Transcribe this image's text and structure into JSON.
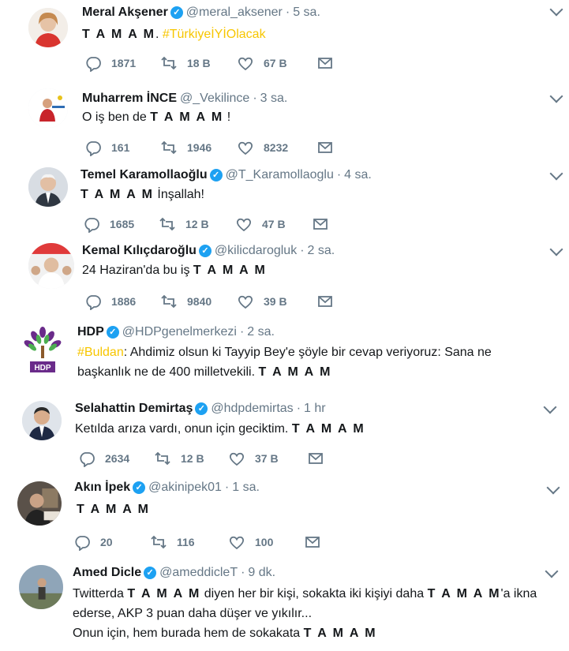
{
  "tweets": [
    {
      "name": "Meral Akşener",
      "verified": true,
      "handle": "@meral_aksener",
      "time": "5 sa.",
      "text": "T A M A M",
      "text_after": ".",
      "hashtag": "#TürkiyeİYİOlacak",
      "replies": "1871",
      "retweets": "18 B",
      "likes": "67 B"
    },
    {
      "name": "Muharrem İNCE",
      "verified": false,
      "handle": "@_Vekilince",
      "time": "3 sa.",
      "text_before": "O iş ben de",
      "text": "T A M A M",
      "text_after": "!",
      "replies": "161",
      "retweets": "1946",
      "likes": "8232"
    },
    {
      "name": "Temel Karamollaoğlu",
      "verified": true,
      "handle": "@T_Karamollaoglu",
      "time": "4 sa.",
      "text": "T A M A M",
      "text_after": "İnşallah!",
      "replies": "1685",
      "retweets": "12 B",
      "likes": "47 B"
    },
    {
      "name": "Kemal Kılıçdaroğlu",
      "verified": true,
      "handle": "@kilicdarogluk",
      "time": "2 sa.",
      "text_before": "24 Haziran'da bu iş",
      "text": "T A M A M",
      "replies": "1886",
      "retweets": "9840",
      "likes": "39 B"
    },
    {
      "name": "HDP",
      "verified": true,
      "handle": "@HDPgenelmerkezi",
      "time": "2 sa.",
      "hashtag": "#Buldan",
      "text_line1": ": Ahdimiz olsun ki Tayyip Bey'e şöyle bir cevap veriyoruz: Sana ne",
      "text_line2": "başkanlık ne de 400 milletvekili.",
      "text": "T A M A M",
      "avatar_label": "HDP"
    },
    {
      "name": "Selahattin Demirtaş",
      "verified": true,
      "handle": "@hdpdemirtas",
      "time": "1 hr",
      "text_before": "Ketılda arıza vardı, onun için geciktim.",
      "text": "T A M A M",
      "replies": "2634",
      "retweets": "12 B",
      "likes": "37 B"
    },
    {
      "name": "Akın İpek",
      "verified": true,
      "handle": "@akinipek01",
      "time": "1 sa.",
      "text": "T A M A M",
      "replies": "20",
      "retweets": "116",
      "likes": "100"
    },
    {
      "name": "Amed Dicle",
      "verified": true,
      "handle": "@ameddicleT",
      "time": "9 dk.",
      "line1_a": "Twitterda",
      "line1_b": "T A M A M",
      "line1_c": "diyen her bir kişi, sokakta iki kişiyi daha",
      "line1_d": "T A M A M",
      "line1_e": "'a ikna",
      "line2": "ederse, AKP 3 puan daha düşer ve yıkılır...",
      "line3_a": "Onun için, hem burada hem de sokakata",
      "line3_b": "T A M A M"
    }
  ],
  "icons": {
    "reply": "reply-icon",
    "retweet": "retweet-icon",
    "like": "heart-icon",
    "dm": "envelope-icon",
    "more": "chevron-down-icon",
    "verified": "verified-badge-icon"
  },
  "colors": {
    "text": "#14171a",
    "muted": "#657786",
    "verified": "#1da1f2",
    "hashtag": "#f7c600"
  }
}
